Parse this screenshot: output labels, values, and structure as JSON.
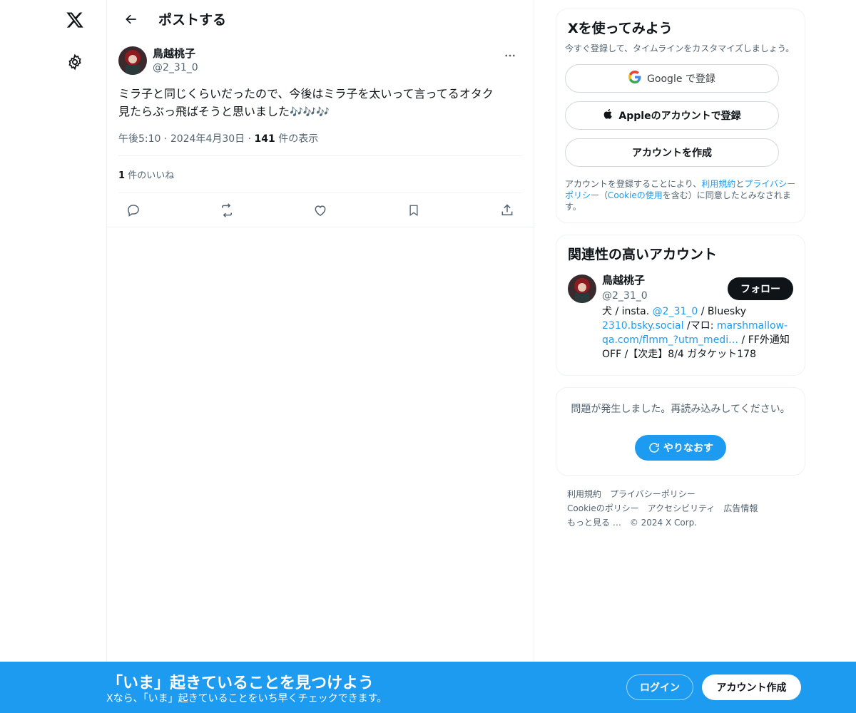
{
  "nav": {
    "logo_icon": "x-logo-icon",
    "settings_icon": "gear-icon"
  },
  "header": {
    "title": "ポストする"
  },
  "post": {
    "author_name": "鳥越桃子",
    "author_handle": "@2_31_0",
    "text": "ミラ子と同じくらいだったので、今後はミラ子を太いって言ってるオタク\n見たらぶっ飛ばそうと思いました",
    "emoji": "🎶🎶🎶",
    "time": "午後5:10",
    "date": "2024年4月30日",
    "views_count": "141",
    "views_label": "件の表示",
    "likes_count": "1",
    "likes_label": "件のいいね",
    "separator": "·"
  },
  "signup": {
    "title": "Xを使ってみよう",
    "subtitle": "今すぐ登録して、タイムラインをカスタマイズしましょう。",
    "google_label": "Google で登録",
    "apple_label": "Appleのアカウントで登録",
    "create_label": "アカウントを作成",
    "legal_prefix": "アカウントを登録することにより、",
    "legal_terms": "利用規約",
    "legal_and": "と",
    "legal_privacy": "プライバシーポリシー",
    "legal_paren_open": "（",
    "legal_cookie": "Cookieの使用",
    "legal_suffix": "を含む）に同意したとみなされます。"
  },
  "related": {
    "title": "関連性の高いアカウント",
    "name": "鳥越桃子",
    "handle": "@2_31_0",
    "follow_label": "フォロー",
    "bio_1": "犬 / insta. ",
    "bio_link_1": "@2_31_0",
    "bio_2": " / Bluesky ",
    "bio_link_2": "2310.bsky.social",
    "bio_3": " /マロ: ",
    "bio_link_3": "marshmallow-qa.com/flmm_?utm_medi…",
    "bio_4": " / FF外通知OFF /【次走】8/4 ガタケット178"
  },
  "error": {
    "message": "問題が発生しました。再読み込みしてください。",
    "retry_label": "やりなおす"
  },
  "footer": {
    "terms": "利用規約",
    "privacy": "プライバシーポリシー",
    "cookie": "Cookieのポリシー",
    "accessibility": "アクセシビリティ",
    "ads": "広告情報",
    "more": "もっと見る …",
    "copyright": "© 2024 X Corp."
  },
  "banner": {
    "title": "「いま」起きていることを見つけよう",
    "description": "Xなら、「いま」起きていることをいち早くチェックできます。",
    "login_label": "ログイン",
    "create_label": "アカウント作成"
  },
  "colors": {
    "accent": "#1d9bf0",
    "text": "#0f1419",
    "secondary": "#536471",
    "border": "#eff3f4"
  }
}
